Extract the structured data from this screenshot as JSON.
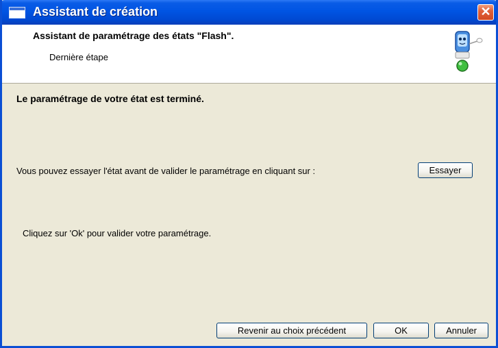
{
  "window": {
    "title": "Assistant de création",
    "close_glyph": "✕"
  },
  "header": {
    "title": "Assistant de paramétrage des états \"Flash\".",
    "subtitle": "Dernière étape",
    "mascot_icon": "assistant-mascot-icon"
  },
  "content": {
    "heading": "Le paramétrage de votre état est terminé.",
    "test_prompt": "Vous pouvez essayer l'état avant de valider le paramétrage en cliquant sur :",
    "test_button_label": "Essayer",
    "validate_hint": "Cliquez sur 'Ok' pour valider votre paramétrage."
  },
  "buttons": {
    "back_label": "Revenir au choix précédent",
    "ok_label": "OK",
    "cancel_label": "Annuler"
  },
  "colors": {
    "titlebar": "#0054e3",
    "dialog_background": "#ece9d8",
    "close_button": "#d24a22"
  }
}
